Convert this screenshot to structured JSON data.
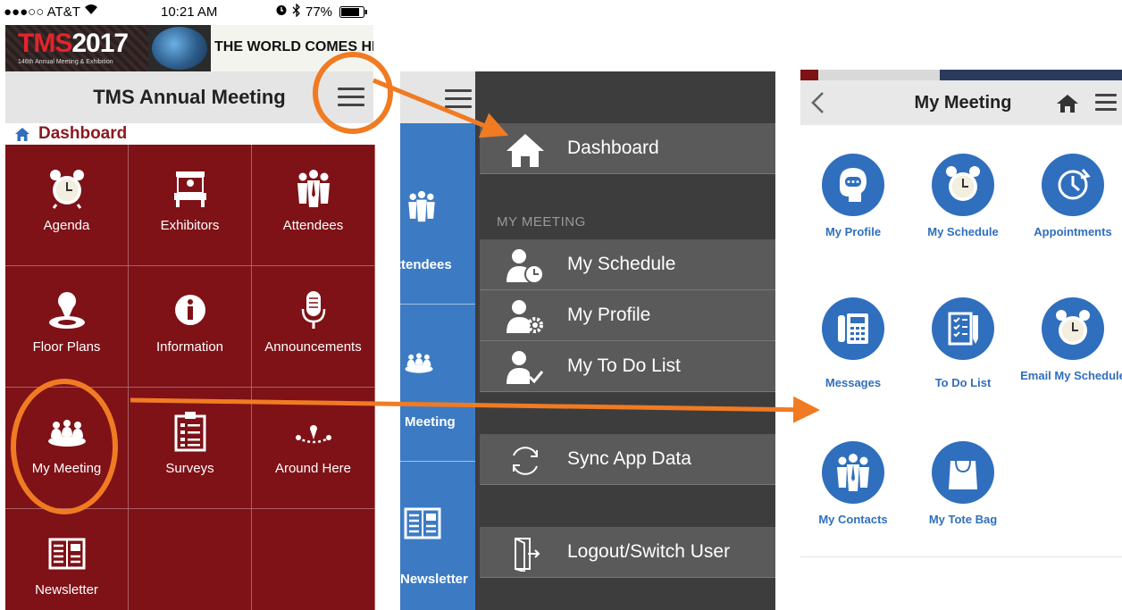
{
  "colors": {
    "maroon": "#7e1217",
    "blue": "#2f6fbd",
    "menu_bg": "#3d3d3d",
    "menu_row": "#5a5a5a",
    "annotation": "#f07b22"
  },
  "status_bar": {
    "carrier": "●●●○○ AT&T",
    "time": "10:21 AM",
    "battery": "77%"
  },
  "banner": {
    "logo_tms": "TMS",
    "logo_year": "2017",
    "subtitle": "146th Annual Meeting & Exhibition",
    "tagline": "THE WORLD COMES HERE."
  },
  "dashboard": {
    "title": "TMS Annual Meeting",
    "breadcrumb": "Dashboard",
    "tiles": [
      {
        "label": "Agenda",
        "icon": "alarm-clock-icon"
      },
      {
        "label": "Exhibitors",
        "icon": "booth-icon"
      },
      {
        "label": "Attendees",
        "icon": "people-icon"
      },
      {
        "label": "Floor Plans",
        "icon": "map-pin-icon"
      },
      {
        "label": "Information",
        "icon": "info-icon"
      },
      {
        "label": "Announcements",
        "icon": "microphone-icon"
      },
      {
        "label": "My Meeting",
        "icon": "meeting-table-icon"
      },
      {
        "label": "Surveys",
        "icon": "clipboard-icon"
      },
      {
        "label": "Around Here",
        "icon": "location-icon"
      },
      {
        "label": "Newsletter",
        "icon": "newspaper-icon"
      }
    ]
  },
  "menu": {
    "side_labels": [
      "ttendees",
      "Meeting",
      "Newsletter"
    ],
    "dashboard": "Dashboard",
    "section": "MY MEETING",
    "items": [
      "My Schedule",
      "My Profile",
      "My To Do List"
    ],
    "sync": "Sync App Data",
    "logout": "Logout/Switch User"
  },
  "my_meeting": {
    "title": "My Meeting",
    "icons": [
      {
        "label": "My Profile",
        "icon": "profile-icon"
      },
      {
        "label": "My Schedule",
        "icon": "alarm-clock-icon"
      },
      {
        "label": "Appointments",
        "icon": "clock-arrow-icon"
      },
      {
        "label": "Messages",
        "icon": "phone-icon"
      },
      {
        "label": "To Do List",
        "icon": "checklist-icon"
      },
      {
        "label": "Email My Schedule",
        "icon": "alarm-clock-icon"
      },
      {
        "label": "My Contacts",
        "icon": "people-icon"
      },
      {
        "label": "My Tote Bag",
        "icon": "bag-icon"
      }
    ]
  }
}
